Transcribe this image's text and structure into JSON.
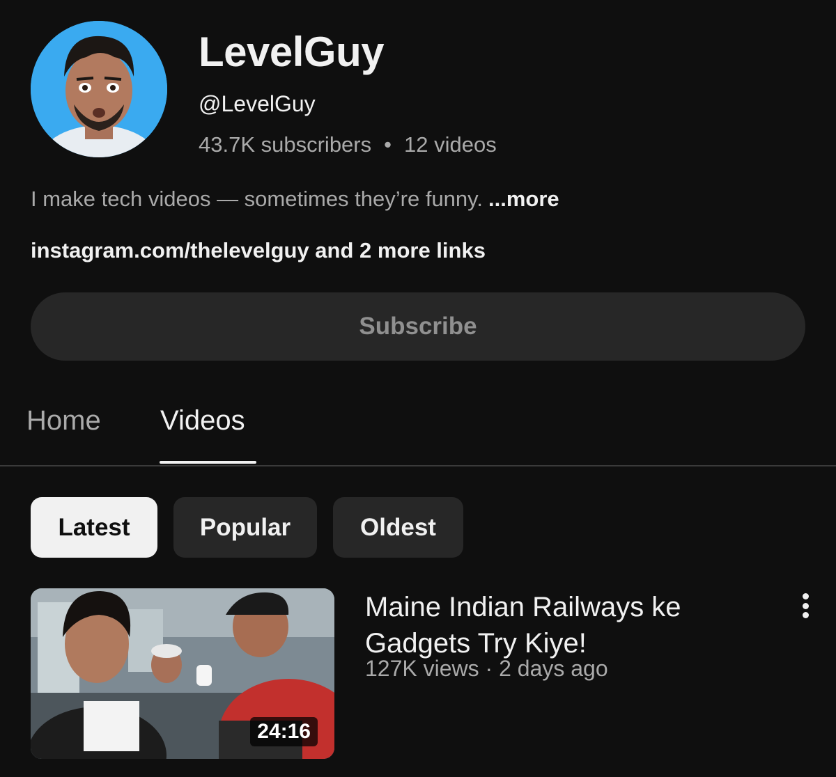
{
  "channel": {
    "name": "LevelGuy",
    "handle": "@LevelGuy",
    "subscribers": "43.7K subscribers",
    "separator": "•",
    "videos_count": "12 videos",
    "description": "I make tech videos — sometimes they’re funny.",
    "more_label": "...more",
    "links": "instagram.com/thelevelguy and 2 more links"
  },
  "subscribe_label": "Subscribe",
  "tabs": [
    {
      "label": "Home",
      "active": false
    },
    {
      "label": "Videos",
      "active": true
    }
  ],
  "chips": [
    {
      "label": "Latest",
      "active": true
    },
    {
      "label": "Popular",
      "active": false
    },
    {
      "label": "Oldest",
      "active": false
    }
  ],
  "videos": [
    {
      "title": "Maine Indian Railways ke Gadgets Try Kiye!",
      "views": "127K views",
      "age": "2 days ago",
      "meta_separator": "·",
      "duration": "24:16"
    }
  ],
  "icons": {
    "menu": "more-vertical-icon"
  },
  "colors": {
    "background": "#0f0f0f",
    "text_primary": "#f1f1f1",
    "text_secondary": "#aaaaaa",
    "button_bg": "#272727",
    "chip_active_bg": "#f1f1f1"
  }
}
